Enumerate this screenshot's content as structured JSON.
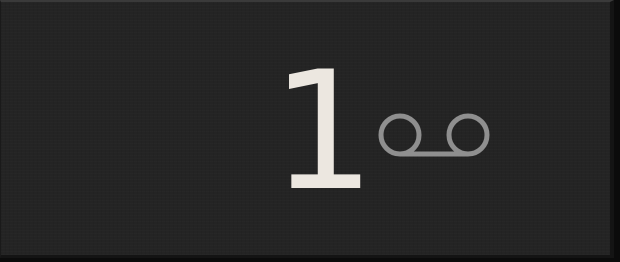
{
  "voicemail_badge": {
    "count": "1",
    "icon": "voicemail-icon",
    "colors": {
      "background": "#242424",
      "count_text": "#ece7e0",
      "icon": "#8f8f8f"
    }
  }
}
